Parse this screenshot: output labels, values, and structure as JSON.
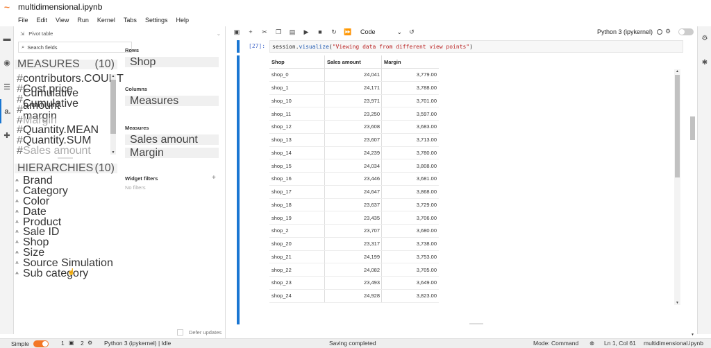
{
  "app": {
    "title": "multidimensional.ipynb"
  },
  "menu": [
    "File",
    "Edit",
    "View",
    "Run",
    "Kernel",
    "Tabs",
    "Settings",
    "Help"
  ],
  "pivot": {
    "header": "Pivot table",
    "search_placeholder": "Search fields",
    "measures_label": "MEASURES",
    "measures_count": "(10)",
    "measures": [
      {
        "label": "contributors.COUNT",
        "dim": false
      },
      {
        "label": "Cost price",
        "dim": false
      },
      {
        "label": "Cumulative amount",
        "dim": false
      },
      {
        "label": "Cumulative margin",
        "dim": false
      },
      {
        "label": "Margin",
        "dim": true
      },
      {
        "label": "Quantity.MEAN",
        "dim": false
      },
      {
        "label": "Quantity.SUM",
        "dim": false
      },
      {
        "label": "Sales amount",
        "dim": true
      }
    ],
    "hierarchies_label": "HIERARCHIES",
    "hierarchies_count": "(10)",
    "hierarchies": [
      "Brand",
      "Category",
      "Color",
      "Date",
      "Product",
      "Sale ID",
      "Shop",
      "Size",
      "Source Simulation",
      "Sub category"
    ],
    "rows_label": "Rows",
    "rows": [
      "Shop"
    ],
    "columns_label": "Columns",
    "columns": [
      "Measures"
    ],
    "measures_zone_label": "Measures",
    "measures_zone": [
      "Sales amount",
      "Margin"
    ],
    "filters_label": "Widget filters",
    "filters_empty": "No filters",
    "defer_label": "Defer updates"
  },
  "toolbar": {
    "cell_type": "Code",
    "kernel": "Python 3 (ipykernel)"
  },
  "cell": {
    "prompt": "[27]:",
    "code_obj": "session.",
    "code_fn": "visualize",
    "code_open": "(",
    "code_str": "\"Viewing data from different view points\"",
    "code_close": ")"
  },
  "table": {
    "headers": [
      "Shop",
      "Sales amount",
      "Margin"
    ],
    "rows": [
      [
        "shop_0",
        "24,041",
        "3,779.00"
      ],
      [
        "shop_1",
        "24,171",
        "3,788.00"
      ],
      [
        "shop_10",
        "23,971",
        "3,701.00"
      ],
      [
        "shop_11",
        "23,250",
        "3,597.00"
      ],
      [
        "shop_12",
        "23,608",
        "3,683.00"
      ],
      [
        "shop_13",
        "23,607",
        "3,713.00"
      ],
      [
        "shop_14",
        "24,239",
        "3,780.00"
      ],
      [
        "shop_15",
        "24,034",
        "3,808.00"
      ],
      [
        "shop_16",
        "23,446",
        "3,681.00"
      ],
      [
        "shop_17",
        "24,647",
        "3,868.00"
      ],
      [
        "shop_18",
        "23,637",
        "3,729.00"
      ],
      [
        "shop_19",
        "23,435",
        "3,706.00"
      ],
      [
        "shop_2",
        "23,707",
        "3,680.00"
      ],
      [
        "shop_20",
        "23,317",
        "3,738.00"
      ],
      [
        "shop_21",
        "24,199",
        "3,753.00"
      ],
      [
        "shop_22",
        "24,082",
        "3,705.00"
      ],
      [
        "shop_23",
        "23,493",
        "3,649.00"
      ],
      [
        "shop_24",
        "24,928",
        "3,823.00"
      ]
    ]
  },
  "status": {
    "mode_label": "Simple",
    "terminals": "1",
    "kernels": "2",
    "kernel_status": "Python 3 (ipykernel) | Idle",
    "save_status": "Saving completed",
    "mode": "Mode: Command",
    "cursor": "Ln 1, Col 61",
    "file": "multidimensional.ipynb"
  },
  "colors": {
    "accent": "#1976d2",
    "brand": "#f37726"
  }
}
